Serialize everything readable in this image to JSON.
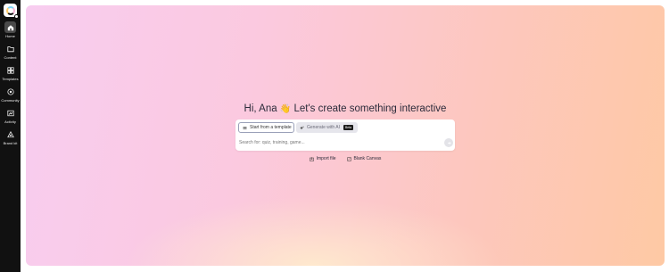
{
  "sidebar": {
    "logo_icon": "genially-logo-icon",
    "items": [
      {
        "label": "Home",
        "icon": "home-icon",
        "active": true
      },
      {
        "label": "Content",
        "icon": "folder-icon",
        "active": false
      },
      {
        "label": "Templates",
        "icon": "templates-icon",
        "active": false
      },
      {
        "label": "Community",
        "icon": "community-icon",
        "active": false
      },
      {
        "label": "Activity",
        "icon": "activity-icon",
        "active": false
      },
      {
        "label": "Brand kit",
        "icon": "brand-kit-icon",
        "active": false
      }
    ]
  },
  "main": {
    "greeting": "Hi, Ana",
    "wave": "👋",
    "headline_rest": "Let's create something interactive",
    "tabs": {
      "template_label": "Start from a template",
      "ai_label": "Generate with AI",
      "beta_label": "Beta"
    },
    "search": {
      "placeholder": "Search for: quiz, training, game..."
    },
    "actions": {
      "import_label": "Import file",
      "blank_label": "Blank Canvas"
    }
  },
  "colors": {
    "sidebar_bg": "#111111",
    "gradient_start": "#f8cdf0",
    "gradient_end": "#fec9a4",
    "beta_bg": "#1b1b1b"
  }
}
